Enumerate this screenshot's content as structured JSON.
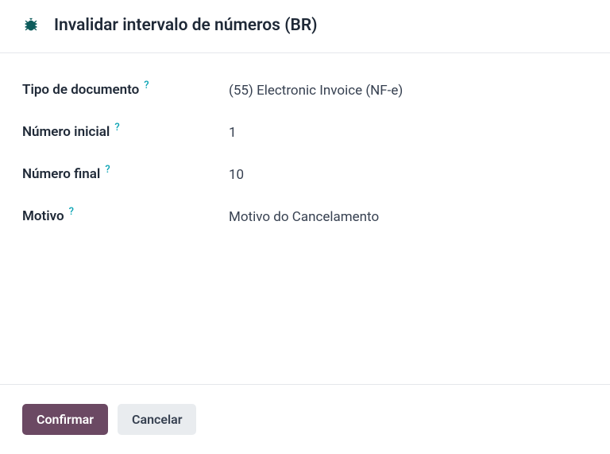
{
  "modal": {
    "title": "Invalidar intervalo de números (BR)",
    "icon": "bug-icon"
  },
  "form": {
    "fields": [
      {
        "label": "Tipo de documento",
        "value": "(55) Electronic Invoice (NF-e)"
      },
      {
        "label": "Número inicial",
        "value": "1"
      },
      {
        "label": "Número final",
        "value": "10"
      },
      {
        "label": "Motivo",
        "value": "Motivo do Cancelamento"
      }
    ]
  },
  "footer": {
    "confirm_label": "Confirmar",
    "cancel_label": "Cancelar"
  },
  "help_icon": "?"
}
